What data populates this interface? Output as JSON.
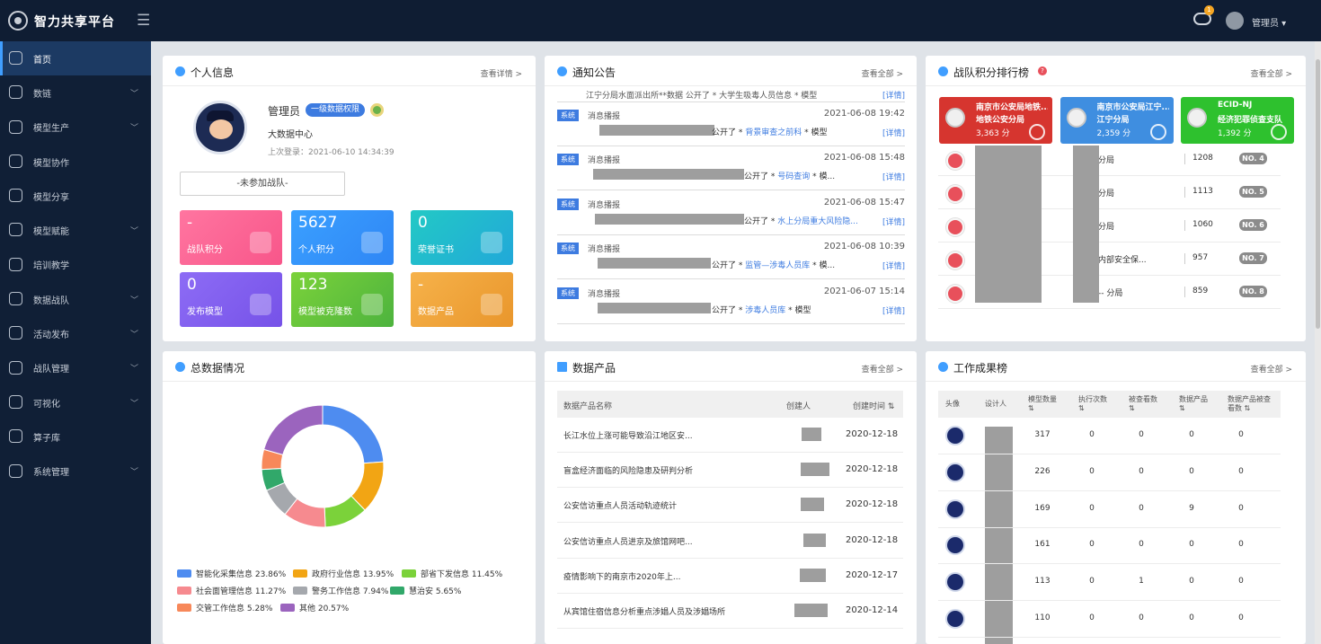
{
  "app": {
    "title": "智力共享平台",
    "notification_count": "1",
    "user": "管理员"
  },
  "sidebar": {
    "items": [
      {
        "label": "首页",
        "icon": "home-icon",
        "chevron": ""
      },
      {
        "label": "数链",
        "icon": "chain-icon",
        "chevron": "﹀"
      },
      {
        "label": "模型生产",
        "icon": "cube-icon",
        "chevron": "﹀"
      },
      {
        "label": "模型协作",
        "icon": "network-icon",
        "chevron": ""
      },
      {
        "label": "模型分享",
        "icon": "share-icon",
        "chevron": ""
      },
      {
        "label": "模型赋能",
        "icon": "model-icon",
        "chevron": "﹀"
      },
      {
        "label": "培训教学",
        "icon": "play-icon",
        "chevron": ""
      },
      {
        "label": "数据战队",
        "icon": "star-icon",
        "chevron": "﹀"
      },
      {
        "label": "活动发布",
        "icon": "trophy-icon",
        "chevron": "﹀"
      },
      {
        "label": "战队管理",
        "icon": "badge-icon",
        "chevron": "﹀"
      },
      {
        "label": "可视化",
        "icon": "chart-icon",
        "chevron": "﹀"
      },
      {
        "label": "算子库",
        "icon": "code-icon",
        "chevron": ""
      },
      {
        "label": "系统管理",
        "icon": "settings-icon",
        "chevron": "﹀"
      }
    ]
  },
  "profile": {
    "title": "个人信息",
    "more": "查看详情 >",
    "name": "管理员",
    "permission": "一级数据权限",
    "dept": "大数据中心",
    "last_login": "上次登录：2021-06-10 14:34:39",
    "team": "-未参加战队-",
    "tiles": [
      {
        "value": "-",
        "label": "战队积分"
      },
      {
        "value": "5627",
        "label": "个人积分"
      },
      {
        "value": "0",
        "label": "荣誉证书"
      },
      {
        "value": "0",
        "label": "发布模型"
      },
      {
        "value": "123",
        "label": "模型被克隆数"
      },
      {
        "value": "-",
        "label": "数据产品"
      }
    ]
  },
  "notices": {
    "title": "通知公告",
    "more": "查看全部 >",
    "partial_text": "江宁分局水面派出所**数据 公开了 * 大学生吸毒人员信息 * 模型",
    "tag": "系统",
    "source": "消息播报",
    "link": "[详情]",
    "items": [
      {
        "time": "2021-06-08 19:42",
        "text": "公开了 *",
        "model": "背景审查之前科",
        "suffix": "* 模型"
      },
      {
        "time": "2021-06-08 15:48",
        "text": "公开了 *",
        "model": "号码查询",
        "suffix": "* 模..."
      },
      {
        "time": "2021-06-08 15:47",
        "text": "公开了 *",
        "model": "水上分局重大风险隐...",
        "suffix": ""
      },
      {
        "time": "2021-06-08 10:39",
        "text": "公开了 *",
        "model": "监管—涉毒人员库",
        "suffix": "* 模..."
      },
      {
        "time": "2021-06-07 15:14",
        "text": "公开了 *",
        "model": "涉毒人员库",
        "suffix": "* 模型"
      }
    ]
  },
  "ranking": {
    "title": "战队积分排行榜",
    "more": "查看全部 >",
    "top3": [
      {
        "name": "南京市公安局地铁...",
        "sub": "地铁公安分局",
        "score": "3,363",
        "unit": "分",
        "color": "#d6352f"
      },
      {
        "name": "南京市公安局江宁...",
        "sub": "江宁分局",
        "score": "2,359",
        "unit": "分",
        "color": "#3f8ee0"
      },
      {
        "name": "ECID-NJ",
        "sub": "经济犯罪侦查支队",
        "score": "1,392",
        "unit": "分",
        "color": "#2ec12e"
      }
    ],
    "rows": [
      {
        "name": "分局",
        "score": "1208",
        "no": "NO. 4"
      },
      {
        "name": "分局",
        "score": "1113",
        "no": "NO. 5"
      },
      {
        "name": "分局",
        "score": "1060",
        "no": "NO. 6"
      },
      {
        "name": "内部安全保...",
        "score": "957",
        "no": "NO. 7"
      },
      {
        "name": "-- 分局",
        "score": "859",
        "no": "NO. 8"
      }
    ]
  },
  "totals": {
    "title": "总数据情况",
    "legend": [
      {
        "label": "智能化采集信息 23.86%",
        "color": "#4e8cf0",
        "value": 23.86
      },
      {
        "label": "政府行业信息 13.95%",
        "color": "#f2a514",
        "value": 13.95
      },
      {
        "label": "部省下发信息 11.45%",
        "color": "#7bd23a",
        "value": 11.45
      },
      {
        "label": "社会面管理信息 11.27%",
        "color": "#f68a8f",
        "value": 11.27
      },
      {
        "label": "警务工作信息 7.94%",
        "color": "#a5a8ad",
        "value": 7.94
      },
      {
        "label": "慧治安 5.65%",
        "color": "#31a86a",
        "value": 5.65
      },
      {
        "label": "交管工作信息 5.28%",
        "color": "#f7885a",
        "value": 5.28
      },
      {
        "label": "其他 20.57%",
        "color": "#9b64be",
        "value": 20.57
      }
    ]
  },
  "chart_data": {
    "type": "pie",
    "categories": [
      "智能化采集信息",
      "政府行业信息",
      "部省下发信息",
      "社会面管理信息",
      "警务工作信息",
      "慧治安",
      "交管工作信息",
      "其他"
    ],
    "values": [
      23.86,
      13.95,
      11.45,
      11.27,
      7.94,
      5.65,
      5.28,
      20.57
    ]
  },
  "products": {
    "title": "数据产品",
    "more": "查看全部 >",
    "columns": [
      "数据产品名称",
      "创建人",
      "创建时间 ⇅"
    ],
    "rows": [
      {
        "name": "长江水位上涨可能导致沿江地区安...",
        "date": "2020-12-18"
      },
      {
        "name": "盲盒经济面临的风险隐患及研判分析",
        "date": "2020-12-18"
      },
      {
        "name": "公安信访重点人员活动轨迹统计",
        "date": "2020-12-18"
      },
      {
        "name": "公安信访重点人员进京及旅馆网吧...",
        "date": "2020-12-18"
      },
      {
        "name": "疫情影响下的南京市2020年上...",
        "date": "2020-12-17"
      },
      {
        "name": "从宾馆住宿信息分析重点涉娼人员及涉娼场所",
        "date": "2020-12-14"
      }
    ]
  },
  "work": {
    "title": "工作成果榜",
    "more": "查看全部 >",
    "columns": [
      "头像",
      "设计人",
      "模型数量 ⇅",
      "执行次数 ⇅",
      "被查看数 ⇅",
      "数据产品 ⇅",
      "数据产品被查看数 ⇅"
    ],
    "rows": [
      {
        "c1": "317",
        "c2": "0",
        "c3": "0",
        "c4": "0",
        "c5": "0"
      },
      {
        "c1": "226",
        "c2": "0",
        "c3": "0",
        "c4": "0",
        "c5": "0"
      },
      {
        "c1": "169",
        "c2": "0",
        "c3": "0",
        "c4": "9",
        "c5": "0"
      },
      {
        "c1": "161",
        "c2": "0",
        "c3": "0",
        "c4": "0",
        "c5": "0"
      },
      {
        "c1": "113",
        "c2": "0",
        "c3": "1",
        "c4": "0",
        "c5": "0"
      },
      {
        "c1": "110",
        "c2": "0",
        "c3": "0",
        "c4": "0",
        "c5": "0"
      }
    ]
  }
}
